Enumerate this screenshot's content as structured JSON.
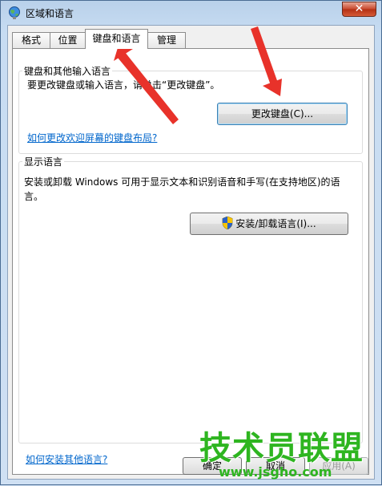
{
  "window": {
    "title": "区域和语言",
    "close_label": "✕"
  },
  "tabs": [
    {
      "label": "格式"
    },
    {
      "label": "位置"
    },
    {
      "label": "键盘和语言",
      "active": true
    },
    {
      "label": "管理"
    }
  ],
  "keyboard_group": {
    "title": "键盘和其他输入语言",
    "description": "要更改键盘或输入语言，请单击“更改键盘”。",
    "change_button": "更改键盘(C)...",
    "welcome_link": "如何更改欢迎屏幕的键盘布局?"
  },
  "display_group": {
    "title": "显示语言",
    "description_line1": "安装或卸载 Windows 可用于显示文本和识别语音和手写(在支持地区)的语",
    "description_line2": "言。",
    "install_button": "安装/卸载语言(I)..."
  },
  "install_link": "如何安装其他语言?",
  "footer": {
    "ok": "确定",
    "cancel": "取消",
    "apply": "应用(A)"
  },
  "watermark": {
    "brand": "技术员联盟",
    "url": "www.jsgho.com"
  },
  "colors": {
    "arrow": "#e8322a",
    "link": "#0066cc",
    "watermark": "#2eb520"
  }
}
